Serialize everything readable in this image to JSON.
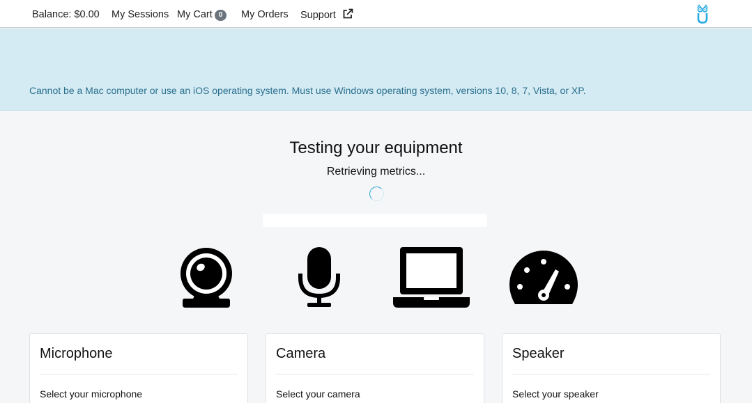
{
  "nav": {
    "balance": "Balance: $0.00",
    "sessions": "My Sessions",
    "cart": "My Cart",
    "cart_count": "0",
    "orders": "My Orders",
    "support": "Support"
  },
  "banner": {
    "message": "Cannot be a Mac computer or use an iOS operating system. Must use Windows operating system, versions 10, 8, 7, Vista, or XP."
  },
  "test": {
    "title": "Testing your equipment",
    "status": "Retrieving metrics..."
  },
  "equipment_icons": [
    "webcam-icon",
    "microphone-icon",
    "laptop-icon",
    "speedometer-icon"
  ],
  "cards": {
    "microphone": {
      "title": "Microphone",
      "label": "Select your microphone"
    },
    "camera": {
      "title": "Camera",
      "label": "Select your camera"
    },
    "speaker": {
      "title": "Speaker",
      "label": "Select your speaker"
    }
  },
  "colors": {
    "banner_bg": "#d4ebf3",
    "banner_text": "#2a6f8e",
    "accent": "#2aa8d8",
    "badge_bg": "#6c757d"
  }
}
